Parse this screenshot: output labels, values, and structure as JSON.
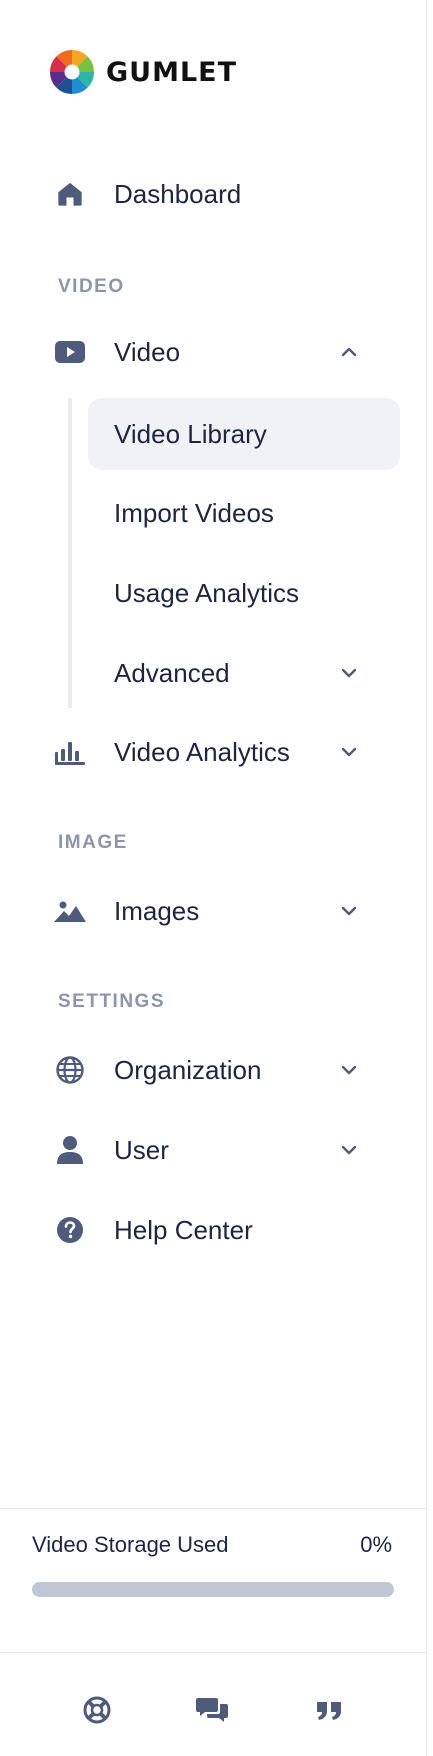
{
  "brand": {
    "name": "GUMLET"
  },
  "nav": {
    "dashboard": {
      "label": "Dashboard",
      "icon": "home-icon"
    },
    "section_video": "VIDEO",
    "video": {
      "label": "Video",
      "icon": "video-play-icon",
      "expanded": true
    },
    "video_sub": [
      {
        "label": "Video Library",
        "active": true
      },
      {
        "label": "Import Videos",
        "active": false
      },
      {
        "label": "Usage Analytics",
        "active": false
      },
      {
        "label": "Advanced",
        "active": false,
        "has_children": true
      }
    ],
    "video_analytics": {
      "label": "Video Analytics",
      "icon": "bar-chart-icon"
    },
    "section_image": "IMAGE",
    "images": {
      "label": "Images",
      "icon": "image-icon"
    },
    "section_settings": "SETTINGS",
    "organization": {
      "label": "Organization",
      "icon": "globe-icon"
    },
    "user": {
      "label": "User",
      "icon": "user-icon"
    },
    "help": {
      "label": "Help Center",
      "icon": "question-circle-icon"
    }
  },
  "storage": {
    "label": "Video Storage Used",
    "percent_text": "0%",
    "percent_value": 0
  },
  "footer": {
    "icons": [
      "support-lifebuoy-icon",
      "chat-icon",
      "quote-icon"
    ]
  },
  "colors": {
    "text": "#1e2540",
    "muted": "#8d95a8",
    "icon": "#4f5b7a",
    "active_bg": "#f0f2f6",
    "bar_track": "#bfc7d5"
  }
}
